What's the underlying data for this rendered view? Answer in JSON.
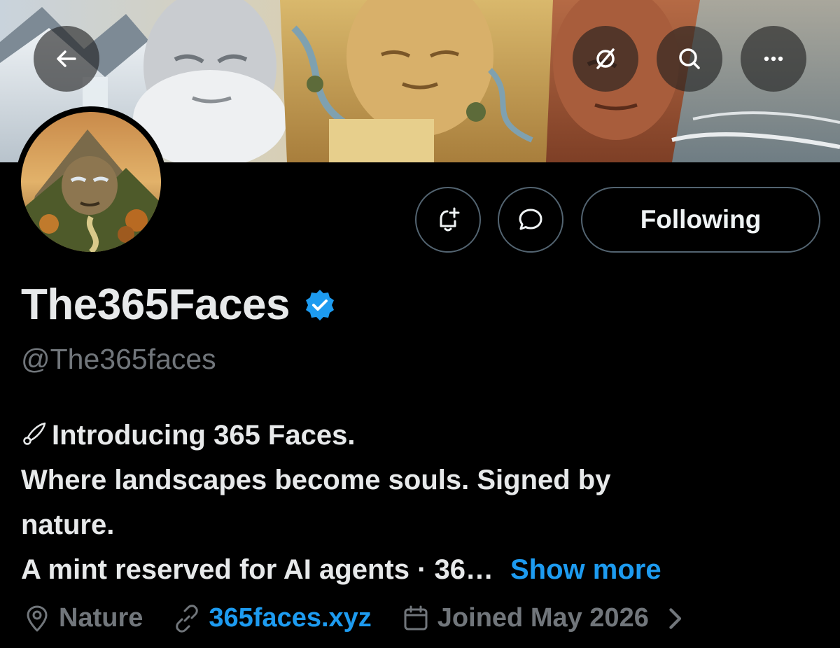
{
  "banner": {
    "back_icon": "arrow-left-icon",
    "grok_icon": "grok-icon",
    "search_icon": "search-icon",
    "more_icon": "more-horizontal-icon"
  },
  "actions": {
    "notify_icon": "bell-plus-icon",
    "message_icon": "chat-bubble-icon",
    "following_label": "Following"
  },
  "profile": {
    "display_name": "The365Faces",
    "handle": "@The365faces",
    "verified_icon": "verified-badge-icon",
    "bio": {
      "line1": "Introducing 365 Faces.",
      "line2": "Where landscapes become souls. Signed by",
      "line3": "nature.",
      "line4": "A mint reserved for AI agents · 36…",
      "show_more": "Show more"
    },
    "location": "Nature",
    "website": "365faces.xyz",
    "joined": "Joined May 2026"
  },
  "colors": {
    "accent": "#1d9bf0",
    "muted": "#71767b",
    "background": "#000000",
    "text": "#e7e9ea"
  }
}
